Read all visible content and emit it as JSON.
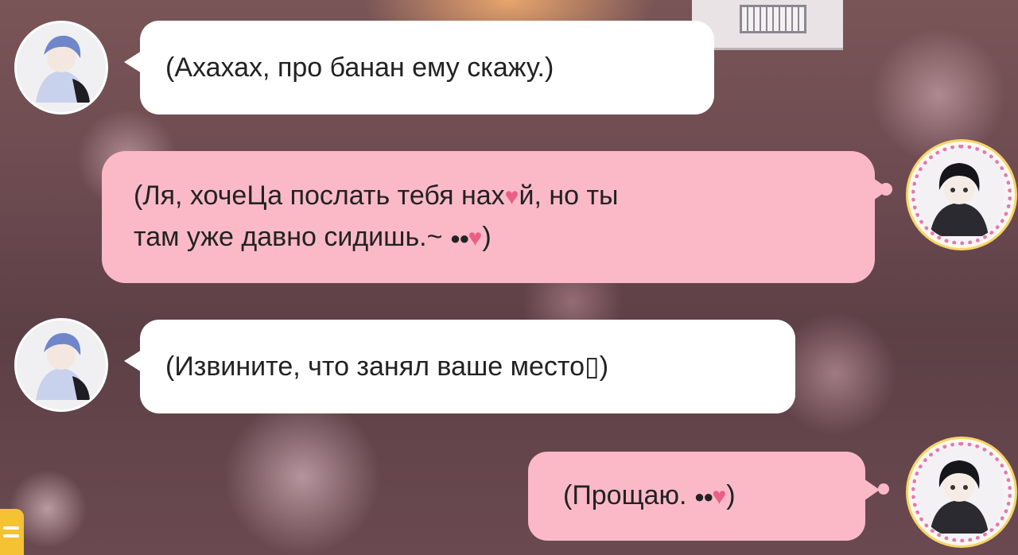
{
  "chat": {
    "messages": [
      {
        "sender": "left",
        "text": "(Ахахах, про банан ему скажу.)"
      },
      {
        "sender": "right",
        "line1": "(Ля, хочеЦа послать тебя нах",
        "line1b": "й, но ты",
        "line2": "там уже давно сидишь.~",
        "line2end": ")"
      },
      {
        "sender": "left",
        "text": "(Извините, что занял ваше место▯)"
      },
      {
        "sender": "right",
        "text": "(Прощаю.",
        "end": ")"
      }
    ]
  },
  "icons": {
    "eyes": "●●",
    "heart": "♥"
  },
  "colors": {
    "incoming_bubble": "#ffffff",
    "outgoing_bubble": "#fbb9c8",
    "heart": "#ea5f85",
    "edge_button": "#f4c232"
  }
}
